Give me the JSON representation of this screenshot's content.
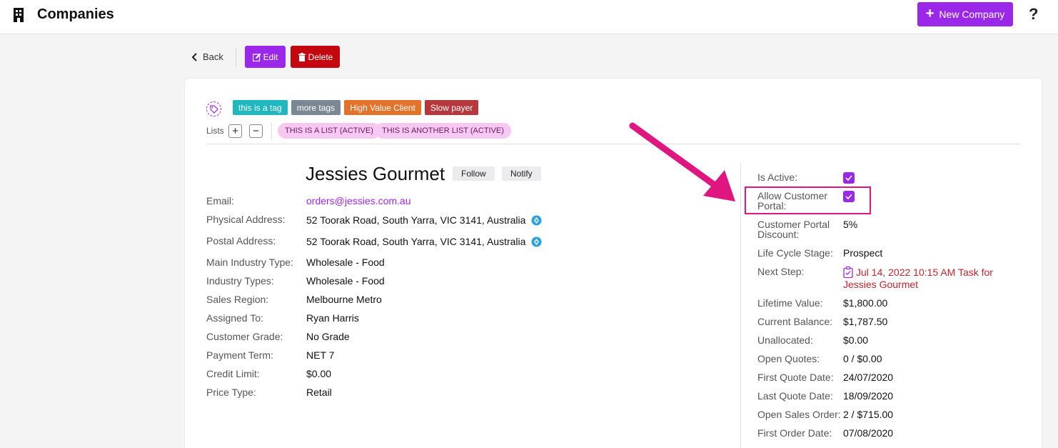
{
  "topbar": {
    "title": "Companies",
    "new_company_label": "New Company",
    "help_label": "?"
  },
  "actions": {
    "back_label": "Back",
    "edit_label": "Edit",
    "delete_label": "Delete"
  },
  "tags": [
    {
      "label": "this is a tag",
      "color": "#1fb8be"
    },
    {
      "label": "more tags",
      "color": "#7b8793"
    },
    {
      "label": "High Value Client",
      "color": "#e3722b"
    },
    {
      "label": "Slow payer",
      "color": "#b6373c"
    }
  ],
  "lists": {
    "label": "Lists",
    "add_label": "+",
    "remove_label": "−",
    "items": [
      "THIS IS A LIST (ACTIVE)",
      "THIS IS ANOTHER LIST (ACTIVE)"
    ]
  },
  "company": {
    "name": "Jessies Gourmet",
    "follow_label": "Follow",
    "notify_label": "Notify"
  },
  "details": [
    {
      "label": "Email:",
      "value": "orders@jessies.com.au"
    },
    {
      "label": "Physical Address:",
      "value": "52 Toorak Road, South Yarra, VIC 3141, Australia"
    },
    {
      "label": "Postal Address:",
      "value": "52 Toorak Road, South Yarra, VIC 3141, Australia"
    },
    {
      "label": "Main Industry Type:",
      "value": "Wholesale - Food"
    },
    {
      "label": "Industry Types:",
      "value": "Wholesale - Food"
    },
    {
      "label": "Sales Region:",
      "value": "Melbourne Metro"
    },
    {
      "label": "Assigned To:",
      "value": "Ryan Harris"
    },
    {
      "label": "Customer Grade:",
      "value": "No Grade"
    },
    {
      "label": "Payment Term:",
      "value": "NET 7"
    },
    {
      "label": "Credit Limit:",
      "value": "$0.00"
    },
    {
      "label": "Price Type:",
      "value": "Retail"
    }
  ],
  "side": {
    "is_active_label": "Is Active:",
    "is_active": true,
    "portal_label_line1": "Allow Customer",
    "portal_label_line2": "Portal:",
    "portal_allowed": true,
    "discount_label_line1": "Customer Portal",
    "discount_label_line2": "Discount:",
    "discount_value": "5%",
    "lifecycle_label": "Life Cycle Stage:",
    "lifecycle_value": "Prospect",
    "next_step_label": "Next Step:",
    "next_step_value": "Jul 14, 2022 10:15 AM Task for Jessies Gourmet",
    "rows": [
      {
        "label": "Lifetime Value:",
        "value": "$1,800.00"
      },
      {
        "label": "Current Balance:",
        "value": "$1,787.50"
      },
      {
        "label": "Unallocated:",
        "value": "$0.00"
      },
      {
        "label": "Open Quotes:",
        "value": "0 / $0.00"
      },
      {
        "label": "First Quote Date:",
        "value": "24/07/2020"
      },
      {
        "label": "Last Quote Date:",
        "value": "18/09/2020"
      },
      {
        "label": "Open Sales Order:",
        "value": "2 / $715.00"
      },
      {
        "label": "First Order Date:",
        "value": "07/08/2020"
      }
    ]
  },
  "colors": {
    "accent": "#9b27e8",
    "danger": "#c4060e",
    "annotation": "#e01680"
  }
}
